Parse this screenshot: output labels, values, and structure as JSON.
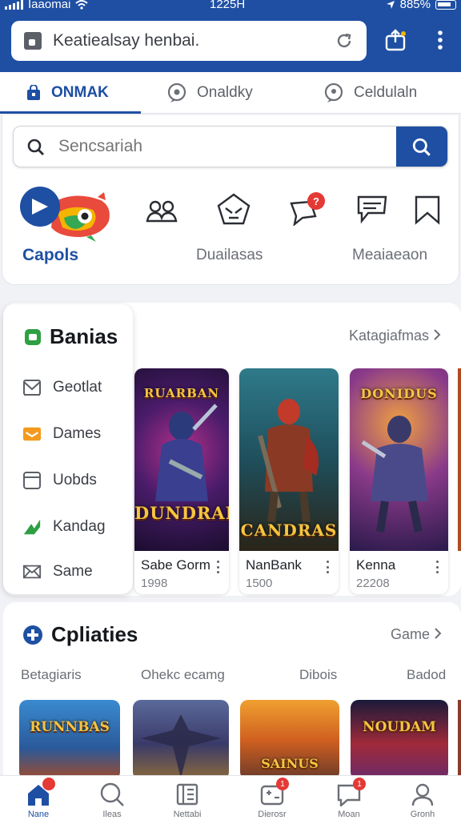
{
  "status_bar": {
    "carrier": "Iaaomai",
    "time": "1225H",
    "battery": "885%"
  },
  "browser": {
    "url_text": "Keatiealsay henbai."
  },
  "tabs": [
    {
      "label": "ONMAK",
      "active": true
    },
    {
      "label": "Onaldky",
      "active": false
    },
    {
      "label": "Celdulaln",
      "active": false
    }
  ],
  "search": {
    "placeholder": "Sencsariah"
  },
  "categories": {
    "logo_label": "Capols",
    "label_middle": "Duailasas",
    "label_right": "Meaiaeaon",
    "icons": [
      "group-icon",
      "pentagon-face-icon",
      "chat-bubble-icon",
      "message-icon",
      "bookmark-icon"
    ],
    "badge_count": "?"
  },
  "side_menu": {
    "title": "Banias",
    "items": [
      {
        "label": "Geotlat",
        "icon": "mail-icon",
        "color": "#5b5f66"
      },
      {
        "label": "Dames",
        "icon": "folder-icon",
        "color": "#f39a1e"
      },
      {
        "label": "Uobds",
        "icon": "window-icon",
        "color": "#5b5f66"
      },
      {
        "label": "Kandag",
        "icon": "trend-icon",
        "color": "#2ea043"
      },
      {
        "label": "Same",
        "icon": "envelope-icon",
        "color": "#5b5f66"
      }
    ]
  },
  "featured": {
    "more_label": "Katagiafmas",
    "games": [
      {
        "title_art": "DUNDRAB",
        "top_art": "RUARBAN",
        "name": "Sabe Gorm",
        "price": "1998"
      },
      {
        "title_art": "CANDRAS",
        "top_art": "",
        "name": "NanBank",
        "price": "1500"
      },
      {
        "title_art": "",
        "top_art": "DONIDUS",
        "name": "Kenna",
        "price": "22208"
      }
    ]
  },
  "section3": {
    "title": "Cpliaties",
    "more_label": "Game",
    "categories": [
      "Betagiaris",
      "Ohekc ecamg",
      "Dibois",
      "Badod"
    ],
    "tiles": [
      {
        "title_art": "RUNNBAS"
      },
      {
        "title_art": ""
      },
      {
        "title_art": "SAINUS"
      },
      {
        "title_art": "NOUDAM"
      }
    ]
  },
  "bottom_nav": [
    {
      "label": "Nane",
      "icon": "home-icon",
      "active": true,
      "badge": ""
    },
    {
      "label": "Ileas",
      "icon": "search-icon",
      "active": false,
      "badge": ""
    },
    {
      "label": "Nettabi",
      "icon": "book-icon",
      "active": false,
      "badge": ""
    },
    {
      "label": "Dierosr",
      "icon": "gamepad-icon",
      "active": false,
      "badge": "1"
    },
    {
      "label": "Moan",
      "icon": "chat-icon",
      "active": false,
      "badge": "1"
    },
    {
      "label": "Gronh",
      "icon": "profile-icon",
      "active": false,
      "badge": ""
    }
  ],
  "colors": {
    "brand": "#1e4fa3",
    "badge": "#e53935",
    "art_gold": "#f4c542"
  }
}
